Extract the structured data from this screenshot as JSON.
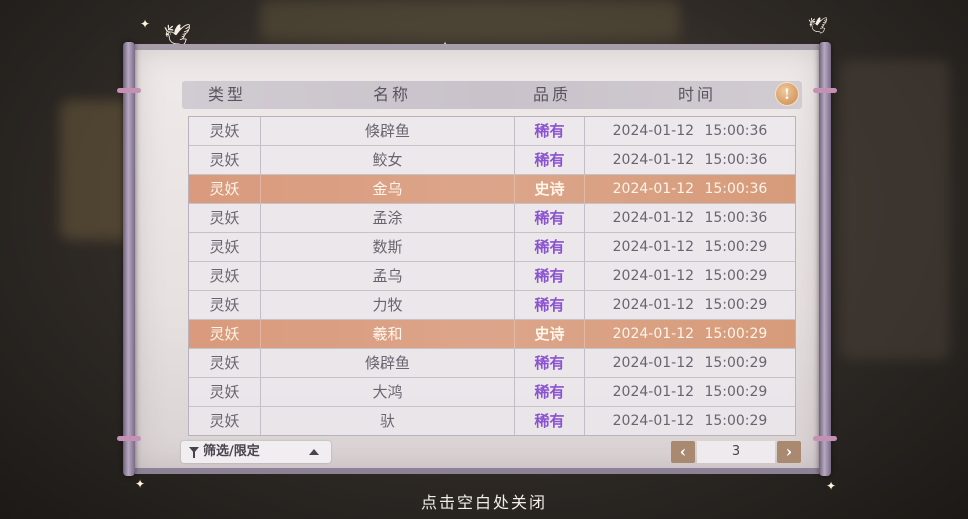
{
  "header": {
    "col_type": "类型",
    "col_name": "名称",
    "col_quality": "品质",
    "col_time": "时间",
    "info_icon": "!"
  },
  "rows": [
    {
      "type": "灵妖",
      "name": "倏辟鱼",
      "quality": "稀有",
      "time": "2024-01-12  15:00:36",
      "epic": false
    },
    {
      "type": "灵妖",
      "name": "鲛女",
      "quality": "稀有",
      "time": "2024-01-12  15:00:36",
      "epic": false
    },
    {
      "type": "灵妖",
      "name": "金乌",
      "quality": "史诗",
      "time": "2024-01-12  15:00:36",
      "epic": true
    },
    {
      "type": "灵妖",
      "name": "孟涂",
      "quality": "稀有",
      "time": "2024-01-12  15:00:36",
      "epic": false
    },
    {
      "type": "灵妖",
      "name": "数斯",
      "quality": "稀有",
      "time": "2024-01-12  15:00:29",
      "epic": false
    },
    {
      "type": "灵妖",
      "name": "孟乌",
      "quality": "稀有",
      "time": "2024-01-12  15:00:29",
      "epic": false
    },
    {
      "type": "灵妖",
      "name": "力牧",
      "quality": "稀有",
      "time": "2024-01-12  15:00:29",
      "epic": false
    },
    {
      "type": "灵妖",
      "name": "羲和",
      "quality": "史诗",
      "time": "2024-01-12  15:00:29",
      "epic": true
    },
    {
      "type": "灵妖",
      "name": "倏辟鱼",
      "quality": "稀有",
      "time": "2024-01-12  15:00:29",
      "epic": false
    },
    {
      "type": "灵妖",
      "name": "大鸿",
      "quality": "稀有",
      "time": "2024-01-12  15:00:29",
      "epic": false
    },
    {
      "type": "灵妖",
      "name": "驮",
      "quality": "稀有",
      "time": "2024-01-12  15:00:29",
      "epic": false
    }
  ],
  "filter": {
    "label": "筛选/限定",
    "icon": "filter-icon"
  },
  "pager": {
    "prev": "‹",
    "next": "›",
    "page": "3"
  },
  "close_hint": "点击空白处关闭",
  "colors": {
    "rare": "#8a53cf",
    "epic_row": "#d99a7d",
    "pager_button": "#a98a70",
    "info_button": "#c9874f"
  }
}
